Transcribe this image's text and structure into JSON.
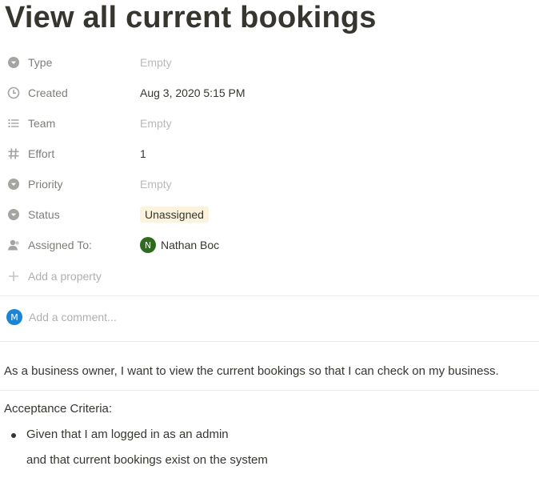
{
  "page": {
    "title": "View all current bookings"
  },
  "properties": [
    {
      "name": "Type",
      "value": "Empty",
      "empty": true,
      "icon": "select-icon"
    },
    {
      "name": "Created",
      "value": "Aug 3, 2020 5:15 PM",
      "empty": false,
      "icon": "clock-icon"
    },
    {
      "name": "Team",
      "value": "Empty",
      "empty": true,
      "icon": "list-icon"
    },
    {
      "name": "Effort",
      "value": "1",
      "empty": false,
      "icon": "hash-icon"
    },
    {
      "name": "Priority",
      "value": "Empty",
      "empty": true,
      "icon": "select-icon"
    },
    {
      "name": "Status",
      "value": "Unassigned",
      "empty": false,
      "icon": "select-icon"
    },
    {
      "name": "Assigned To:",
      "value": "Nathan Boc",
      "empty": false,
      "icon": "person-icon",
      "avatar_initial": "N",
      "avatar_color": "#2e6b1f"
    }
  ],
  "add_property": {
    "label": "Add a property",
    "icon": "plus-icon"
  },
  "comment": {
    "avatar_initial": "M",
    "avatar_color": "#1b84d4",
    "placeholder": "Add a comment..."
  },
  "content": {
    "description": "As a business owner, I want to view the current bookings so that I can check on my business.",
    "criteria_heading": "Acceptance Criteria:",
    "bullet_line_1": "Given that I am logged in as an admin",
    "bullet_line_2": "and that current bookings exist on the system"
  },
  "colors": {
    "status_tag_bg": "#fbf3db",
    "icon_gray": "#a5a4a1"
  }
}
